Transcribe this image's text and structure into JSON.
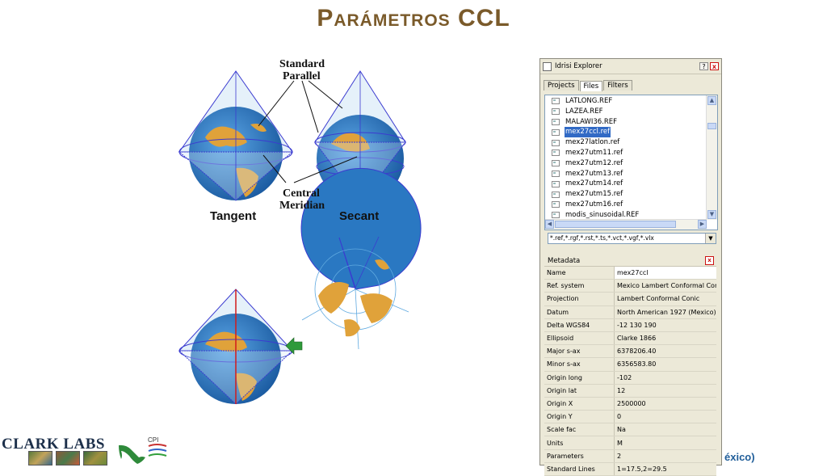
{
  "slide": {
    "title_first_letter": "P",
    "title_rest": "arámetros",
    "title_acronym": "CCL",
    "trailing_text": "éxico)"
  },
  "diagram": {
    "label_standard": "Standard",
    "label_parallel": "Parallel",
    "label_central": "Central",
    "label_meridian": "Meridian",
    "caption_tangent": "Tangent",
    "caption_secant": "Secant"
  },
  "explorer": {
    "title": "Idrisi Explorer",
    "help_button": "?",
    "close_button": "x",
    "tabs": [
      {
        "label": "Projects",
        "active": false
      },
      {
        "label": "Files",
        "active": true
      },
      {
        "label": "Filters",
        "active": false
      }
    ],
    "files": [
      {
        "name": "LATLONG.REF",
        "selected": false
      },
      {
        "name": "LAZEA.REF",
        "selected": false
      },
      {
        "name": "MALAWI36.REF",
        "selected": false
      },
      {
        "name": "mex27ccl.ref",
        "selected": true
      },
      {
        "name": "mex27latlon.ref",
        "selected": false
      },
      {
        "name": "mex27utm11.ref",
        "selected": false
      },
      {
        "name": "mex27utm12.ref",
        "selected": false
      },
      {
        "name": "mex27utm13.ref",
        "selected": false
      },
      {
        "name": "mex27utm14.ref",
        "selected": false
      },
      {
        "name": "mex27utm15.ref",
        "selected": false
      },
      {
        "name": "mex27utm16.ref",
        "selected": false
      },
      {
        "name": "modis_sinusoidal.REF",
        "selected": false
      }
    ],
    "filter_value": "*.ref,*.rgf,*.rst,*.ts,*.vct,*.vgf,*.vlx",
    "metadata_title": "Metadata",
    "metadata": [
      {
        "key": "Name",
        "value": "mex27ccl"
      },
      {
        "key": "Ref. system",
        "value": "Mexico Lambert Conformal Conic"
      },
      {
        "key": "Projection",
        "value": "Lambert Conformal Conic"
      },
      {
        "key": "Datum",
        "value": "North American 1927 (Mexico)"
      },
      {
        "key": "Delta WGS84",
        "value": "-12 130 190"
      },
      {
        "key": "Ellipsoid",
        "value": "Clarke 1866"
      },
      {
        "key": "Major s-ax",
        "value": "6378206.40"
      },
      {
        "key": "Minor s-ax",
        "value": "6356583.80"
      },
      {
        "key": "Origin long",
        "value": "-102"
      },
      {
        "key": "Origin lat",
        "value": "12"
      },
      {
        "key": "Origin X",
        "value": "2500000"
      },
      {
        "key": "Origin Y",
        "value": "0"
      },
      {
        "key": "Scale fac",
        "value": "Na"
      },
      {
        "key": "Units",
        "value": "M"
      },
      {
        "key": "Parameters",
        "value": "2"
      },
      {
        "key": "Standard Lines",
        "value": "1=17.5,2=29.5"
      }
    ]
  },
  "logos": {
    "clark_labs": "CLARK LABS",
    "cpi_text": "CPI"
  },
  "colors": {
    "title": "#7a5a2a",
    "selection": "#316ac5",
    "cone_line": "#3b3bd0",
    "cone_fill": "#cfe6f5",
    "ocean": "#2a78c2",
    "land": "#e0a23a",
    "arrow_green": "#2e9a3a",
    "meridian_red": "#d21b1b"
  }
}
